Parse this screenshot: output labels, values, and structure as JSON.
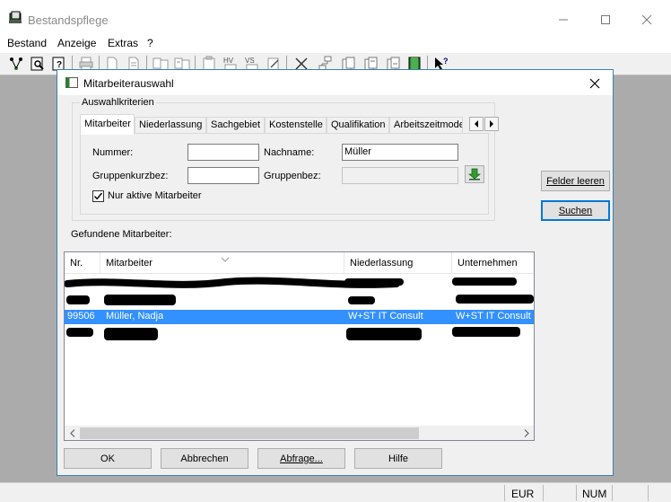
{
  "app": {
    "title": "Bestandspflege"
  },
  "menu": [
    {
      "label": "Bestand"
    },
    {
      "label": "Anzeige"
    },
    {
      "label": "Extras"
    },
    {
      "label": "?"
    }
  ],
  "toolbar": {
    "icons": [
      "network-icon",
      "preview-icon",
      "question-doc-icon",
      "print-icon",
      "new-doc-icon",
      "doc-icon",
      "doc-compare-icon",
      "doc-compare2-icon",
      "clipboard-icon",
      "hv-icon",
      "vs-icon",
      "edit-icon",
      "delete-icon",
      "tree-icon",
      "copy-icon",
      "copy2-icon",
      "copy3-icon",
      "book-icon",
      "help-pointer-icon"
    ],
    "hv_text": "HV",
    "vs_text": "VS"
  },
  "status": {
    "currency": "EUR",
    "numlock": "NUM"
  },
  "dialog": {
    "title": "Mitarbeiterauswahl",
    "group_title": "Auswahlkriterien",
    "tabs": [
      "Mitarbeiter",
      "Niederlassung",
      "Sachgebiet",
      "Kostenstelle",
      "Qualifikation",
      "Arbeitszeitmode"
    ],
    "active_tab": "Mitarbeiter",
    "fields": {
      "nummer_label": "Nummer:",
      "nummer_value": "",
      "nachname_label": "Nachname:",
      "nachname_value": "Müller",
      "gruppenkurzbez_label": "Gruppenkurzbez:",
      "gruppenkurzbez_value": "",
      "gruppenbez_label": "Gruppenbez:",
      "gruppenbez_value": ""
    },
    "checkbox": {
      "label": "Nur aktive Mitarbeiter",
      "checked": true
    },
    "found_label": "Gefundene Mitarbeiter:",
    "list": {
      "columns": [
        "Nr.",
        "Mitarbeiter",
        "Niederlassung",
        "Unternehmen"
      ],
      "rows": [
        {
          "nr": "",
          "mitarbeiter": "",
          "niederlassung": "",
          "unternehmen": "",
          "redacted": true
        },
        {
          "nr": "",
          "mitarbeiter": "",
          "niederlassung": "",
          "unternehmen": "",
          "redacted": true
        },
        {
          "nr": "99506",
          "mitarbeiter": "Müller, Nadja",
          "niederlassung": "W+ST IT Consult",
          "unternehmen": "W+ST IT Consult",
          "selected": true
        },
        {
          "nr": "",
          "mitarbeiter": "",
          "niederlassung": "",
          "unternehmen": "",
          "redacted": true
        }
      ]
    },
    "buttons": {
      "clear": "Felder leeren",
      "search": "Suchen",
      "ok": "OK",
      "cancel": "Abbrechen",
      "query": "Abfrage...",
      "help": "Hilfe"
    }
  },
  "colors": {
    "selection": "#3390ff",
    "dialog_border": "#3c7fb1",
    "default_button_border": "#0078d7",
    "mdi_background": "#ababab"
  }
}
